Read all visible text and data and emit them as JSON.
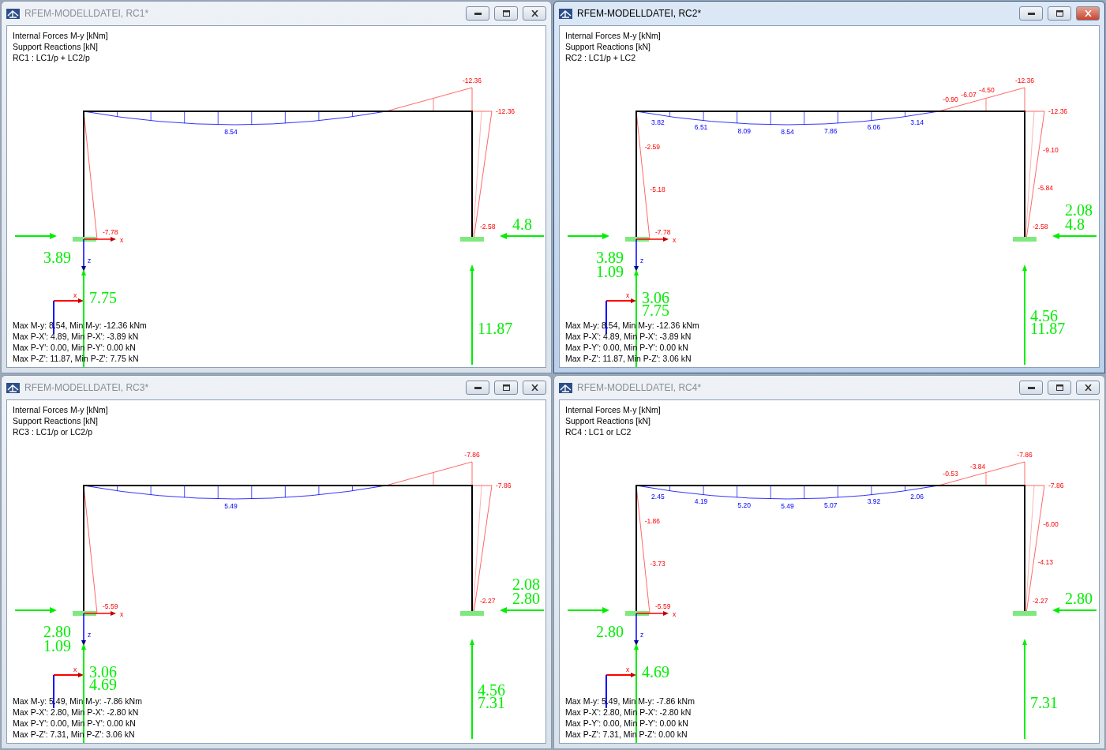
{
  "windows": [
    {
      "title": "RFEM-MODELLDATEI, RC1*",
      "active": false,
      "info": [
        "Internal Forces M-y [kNm]",
        "Support Reactions [kN]",
        "RC1 : LC1/p + LC2/p"
      ],
      "beam_values": [
        "8.54"
      ],
      "hogging_values": [
        "-12.36"
      ],
      "left_column_values": [
        "-7.78"
      ],
      "right_column_values": [
        "-12.36",
        "-2.58"
      ],
      "axes": {
        "x": "x",
        "z": "z",
        "triad_x": "x"
      },
      "reactions": {
        "left_h": [
          "3.89"
        ],
        "left_v": [
          "7.75"
        ],
        "right_h": [
          "4.8"
        ],
        "right_v": [
          "11.87"
        ]
      },
      "summary": [
        "Max M-y: 8.54, Min M-y: -12.36 kNm",
        "Max P-X': 4.89, Min P-X': -3.89 kN",
        "Max P-Y': 0.00, Min P-Y': 0.00 kN",
        "Max P-Z': 11.87, Min P-Z': 7.75 kN"
      ]
    },
    {
      "title": "RFEM-MODELLDATEI, RC2*",
      "active": true,
      "info": [
        "Internal Forces M-y [kNm]",
        "Support Reactions [kN]",
        "RC2 : LC1/p + LC2"
      ],
      "beam_values": [
        "3.82",
        "6.51",
        "8.09",
        "8.54",
        "7.86",
        "6.06",
        "3.14"
      ],
      "hogging_values": [
        "-0.90",
        "-6.07",
        "-4.50",
        "-12.36"
      ],
      "left_column_values": [
        "-2.59",
        "-5.18",
        "-7.78"
      ],
      "right_column_values": [
        "-12.36",
        "-9.10",
        "-5.84",
        "-2.58"
      ],
      "axes": {
        "x": "x",
        "z": "z",
        "triad_x": "x"
      },
      "reactions": {
        "left_h": [
          "3.89",
          "1.09"
        ],
        "left_v": [
          "3.06",
          "7.75"
        ],
        "right_h": [
          "2.08",
          "4.8"
        ],
        "right_v": [
          "4.56",
          "11.87"
        ]
      },
      "summary": [
        "Max M-y: 8.54, Min M-y: -12.36 kNm",
        "Max P-X': 4.89, Min P-X': -3.89 kN",
        "Max P-Y': 0.00, Min P-Y': 0.00 kN",
        "Max P-Z': 11.87, Min P-Z': 3.06 kN"
      ]
    },
    {
      "title": "RFEM-MODELLDATEI, RC3*",
      "active": false,
      "info": [
        "Internal Forces M-y [kNm]",
        "Support Reactions [kN]",
        "RC3 : LC1/p or LC2/p"
      ],
      "beam_values": [
        "5.49"
      ],
      "hogging_values": [
        "-7.86"
      ],
      "left_column_values": [
        "-5.59"
      ],
      "right_column_values": [
        "-7.86",
        "-2.27"
      ],
      "axes": {
        "x": "x",
        "z": "z",
        "triad_x": "x"
      },
      "reactions": {
        "left_h": [
          "2.80",
          "1.09"
        ],
        "left_v": [
          "3.06",
          "4.69"
        ],
        "right_h": [
          "2.08",
          "2.80"
        ],
        "right_v": [
          "4.56",
          "7.31"
        ]
      },
      "summary": [
        "Max M-y: 5.49, Min M-y: -7.86 kNm",
        "Max P-X': 2.80, Min P-X': -2.80 kN",
        "Max P-Y': 0.00, Min P-Y': 0.00 kN",
        "Max P-Z': 7.31, Min P-Z': 3.06 kN"
      ]
    },
    {
      "title": "RFEM-MODELLDATEI, RC4*",
      "active": false,
      "info": [
        "Internal Forces M-y [kNm]",
        "Support Reactions [kN]",
        "RC4 : LC1 or LC2"
      ],
      "beam_values": [
        "2.45",
        "4.19",
        "5.20",
        "5.49",
        "5.07",
        "3.92",
        "2.06"
      ],
      "hogging_values": [
        "-0.53",
        "-3.84",
        "-7.86"
      ],
      "left_column_values": [
        "-1.86",
        "-3.73",
        "-5.59"
      ],
      "right_column_values": [
        "-7.86",
        "-6.00",
        "-4.13",
        "-2.27"
      ],
      "axes": {
        "x": "x",
        "z": "z",
        "triad_x": "x"
      },
      "reactions": {
        "left_h": [
          "2.80"
        ],
        "left_v": [
          "4.69"
        ],
        "right_h": [
          "2.80"
        ],
        "right_v": [
          "7.31"
        ]
      },
      "summary": [
        "Max M-y: 5.49, Min M-y: -7.86 kNm",
        "Max P-X': 2.80, Min P-X': -2.80 kN",
        "Max P-Y': 0.00, Min P-Y': 0.00 kN",
        "Max P-Z': 7.31, Min P-Z': 0.00 kN"
      ]
    }
  ]
}
